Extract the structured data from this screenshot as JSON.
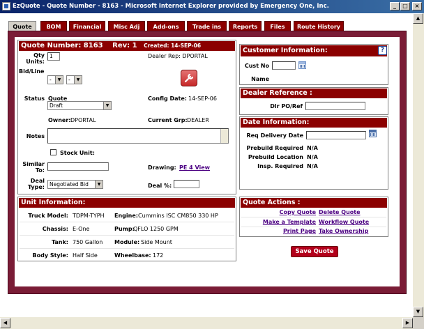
{
  "window": {
    "title": "EzQuote - Quote Number - 8163 - Microsoft Internet Explorer provided by Emergency One, Inc.",
    "minimize_glyph": "_",
    "maximize_glyph": "□",
    "close_glyph": "×"
  },
  "tabs": [
    {
      "label": "Quote",
      "active": true
    },
    {
      "label": "BOM"
    },
    {
      "label": "Financial"
    },
    {
      "label": "Misc Adj"
    },
    {
      "label": "Add-ons"
    },
    {
      "label": "Trade ins"
    },
    {
      "label": "Reports"
    },
    {
      "label": "Files"
    },
    {
      "label": "Route History"
    }
  ],
  "quote": {
    "header_number": "Quote Number: 8163",
    "header_rev": "Rev: 1",
    "header_created": "Created: 14-SEP-06",
    "qty_label": "Qty Units:",
    "qty_value": "1",
    "dealer_rep": "Dealer Rep: DPORTAL",
    "bidline_label": "Bid/Line",
    "bid_select": "-",
    "line_select": "-",
    "status_label": "Status",
    "status_heading": "Quote",
    "status_value": "Draft",
    "config_date_label": "Config Date:",
    "config_date_value": "14-SEP-06",
    "owner_label": "Owner:",
    "owner_value": "DPORTAL",
    "current_grp_label": "Current Grp:",
    "current_grp_value": "DEALER",
    "notes_label": "Notes",
    "notes_value": "",
    "stock_unit_label": "Stock Unit:",
    "similar_label": "Similar To:",
    "similar_value": "",
    "drawing_label": "Drawing:",
    "drawing_link": "PE 4 View",
    "deal_type_label": "Deal Type:",
    "deal_type_value": "Negotiated Bid",
    "deal_pct_label": "Deal %:",
    "deal_pct_value": ""
  },
  "unit": {
    "header": "Unit Information:",
    "truck_model_label": "Truck Model:",
    "truck_model_value": "TDPM-TYPH",
    "engine_label": "Engine:",
    "engine_value": "Cummins ISC CM850 330 HP",
    "chassis_label": "Chassis:",
    "chassis_value": "E-One",
    "pump_label": "Pump:",
    "pump_value": "QFLO 1250 GPM",
    "tank_label": "Tank:",
    "tank_value": "750 Gallon",
    "module_label": "Module:",
    "module_value": "Side Mount",
    "body_style_label": "Body Style:",
    "body_style_value": "Half Side",
    "wheelbase_label": "Wheelbase:",
    "wheelbase_value": "172"
  },
  "customer": {
    "header": "Customer Information:",
    "help_glyph": "?",
    "cust_no_label": "Cust No",
    "cust_no_value": "",
    "name_label": "Name",
    "name_value": ""
  },
  "dealer_ref": {
    "header": "Dealer Reference :",
    "po_label": "Dlr PO/Ref",
    "po_value": ""
  },
  "date_info": {
    "header": "Date Information:",
    "req_delivery_label": "Req Delivery Date",
    "req_delivery_value": "",
    "prebuild_required_label": "Prebuild Required",
    "prebuild_required_value": "N/A",
    "prebuild_location_label": "Prebuild Location",
    "prebuild_location_value": "N/A",
    "insp_required_label": "Insp. Required",
    "insp_required_value": "N/A"
  },
  "actions": {
    "header": "Quote Actions :",
    "copy_quote": "Copy Quote",
    "delete_quote": "Delete Quote",
    "make_template": "Make a Template",
    "workflow_quote": "Workflow Quote",
    "print_page": "Print Page",
    "take_ownership": "Take Ownership",
    "save_quote": "Save Quote"
  },
  "colors": {
    "header_red": "#8b0000",
    "frame_maroon": "#7a1c36",
    "link_purple": "#4b0082",
    "save_button": "#b3001b",
    "title_blue": "#0a246a"
  }
}
